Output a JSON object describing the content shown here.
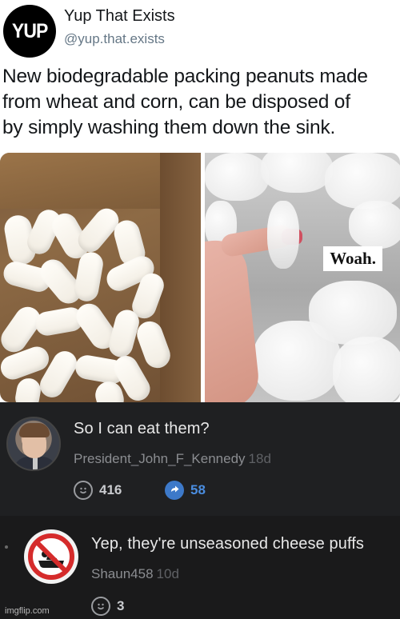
{
  "tweet": {
    "avatar_text": "YUP",
    "display_name": "Yup That Exists",
    "handle": "@yup.that.exists",
    "text_lines": [
      "New biodegradable packing peanuts made",
      "from wheat and corn, can be disposed of",
      "by simply washing them down the sink."
    ],
    "media": {
      "overlay_label": "Woah."
    }
  },
  "comments": [
    {
      "text": "So I can eat them?",
      "username": "President_John_F_Kennedy",
      "age": "18d",
      "likes": "416",
      "shares": "58",
      "avatar_icon": "portrait-avatar"
    },
    {
      "text": "Yep, they're unseasoned cheese puffs",
      "username": "Shaun458",
      "age": "10d",
      "likes": "3",
      "avatar_icon": "no-bathing-sign-avatar"
    }
  ],
  "watermark": "imgflip.com",
  "colors": {
    "tweet_text": "#14171a",
    "handle": "#657786",
    "comment_bg": "#1f2022",
    "share_blue": "#4a8de0"
  }
}
